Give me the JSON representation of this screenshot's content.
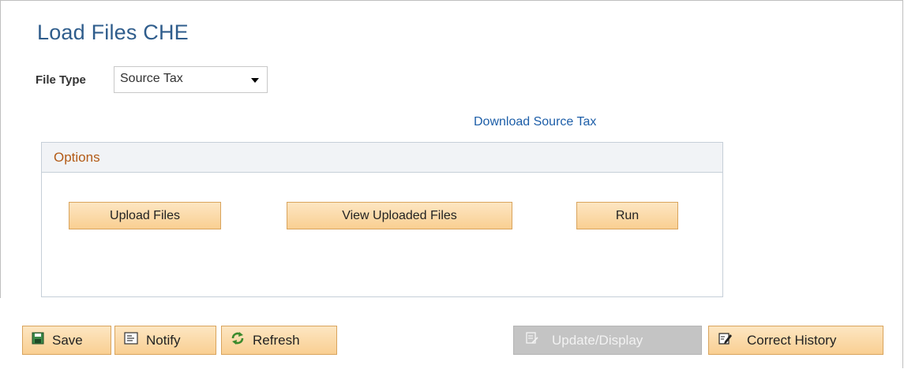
{
  "page": {
    "title": "Load Files CHE"
  },
  "file_type": {
    "label": "File Type",
    "selected": "Source Tax"
  },
  "download_link": "Download Source Tax",
  "options": {
    "title": "Options",
    "buttons": {
      "upload": "Upload Files",
      "view": "View Uploaded Files",
      "run": "Run"
    }
  },
  "toolbar": {
    "save": "Save",
    "notify": "Notify",
    "refresh": "Refresh",
    "update_display": "Update/Display",
    "correct_history": "Correct History"
  },
  "colors": {
    "title": "#2f5d8c",
    "link": "#1d5ea8",
    "options_title": "#b35b17",
    "button_fill": "#f9cf92",
    "button_border": "#d9a45d",
    "disabled": "#c4c4c4"
  },
  "icons": {
    "save": "floppy-disk-icon",
    "notify": "notify-icon",
    "refresh": "refresh-icon",
    "update_display": "update-display-icon",
    "correct_history": "edit-pencil-icon",
    "select": "chevron-down-icon"
  }
}
